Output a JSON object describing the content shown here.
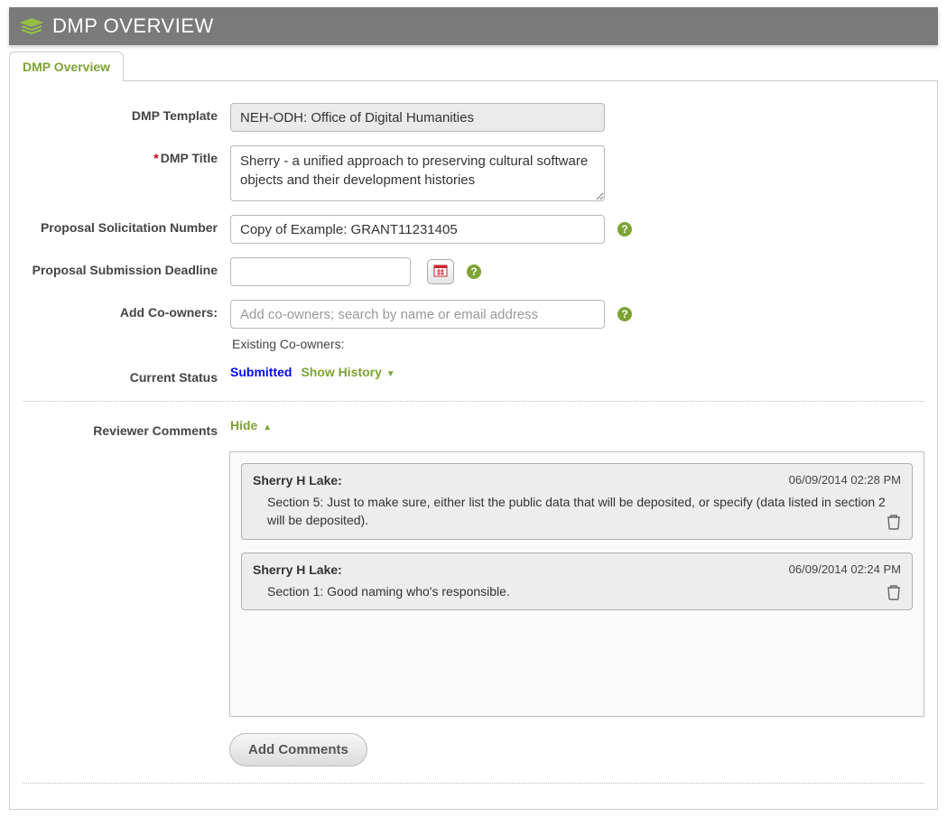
{
  "header": {
    "title": "DMP OVERVIEW"
  },
  "tab": {
    "label": "DMP Overview"
  },
  "labels": {
    "template": "DMP Template",
    "title": "DMP Title",
    "solicitation": "Proposal Solicitation Number",
    "deadline": "Proposal Submission Deadline",
    "coowners": "Add Co-owners:",
    "existing": "Existing Co-owners:",
    "status": "Current Status",
    "reviewer": "Reviewer Comments"
  },
  "fields": {
    "template": "NEH-ODH: Office of Digital Humanities",
    "title": "Sherry - a unified approach to preserving cultural software objects and their development histories",
    "solicitation": "Copy of Example: GRANT11231405",
    "deadline": "",
    "coowners_placeholder": "Add co-owners; search by name or email address"
  },
  "status": {
    "value": "Submitted",
    "history_link": "Show History"
  },
  "comments": {
    "hide_label": "Hide ",
    "add_button": "Add Comments",
    "items": [
      {
        "author": "Sherry H Lake:",
        "timestamp": "06/09/2014 02:28 PM",
        "body": "Section 5: Just to make sure, either list the public data that will be deposited, or specify (data listed in section 2 will be deposited)."
      },
      {
        "author": "Sherry H Lake:",
        "timestamp": "06/09/2014 02:24 PM",
        "body": "Section 1: Good naming who's responsible."
      }
    ]
  }
}
